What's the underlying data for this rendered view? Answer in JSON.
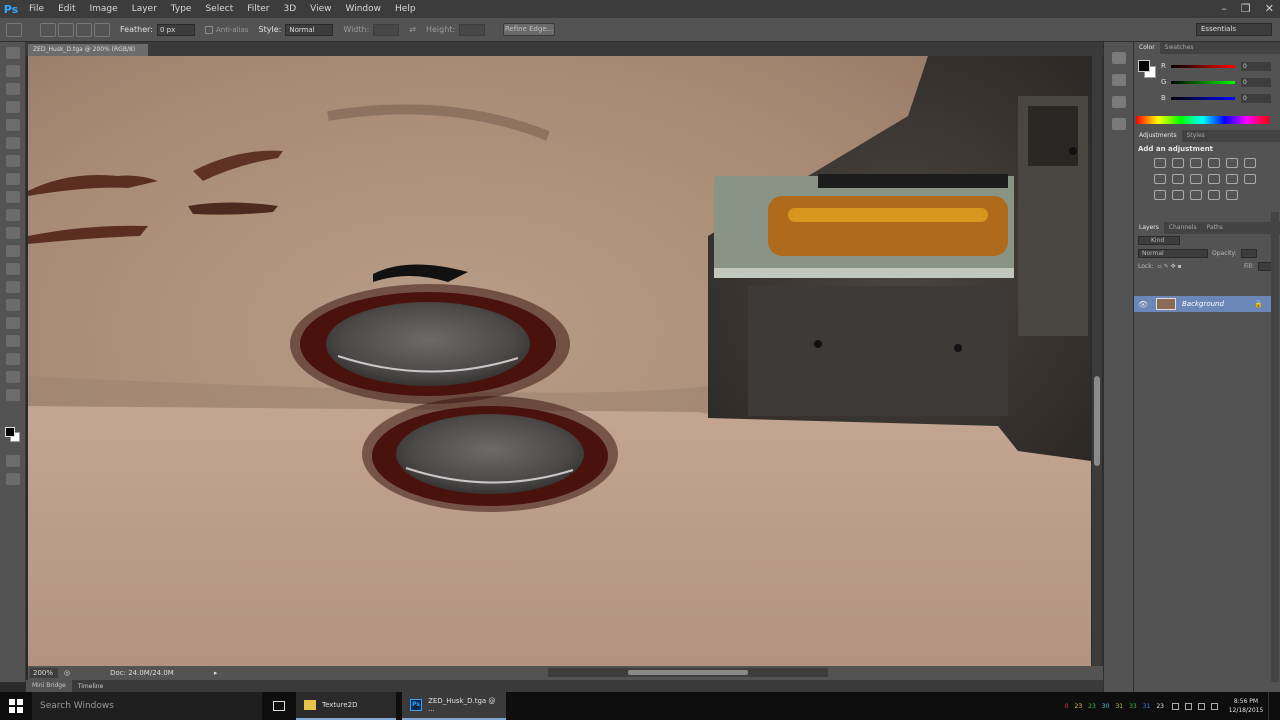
{
  "app": {
    "logo": "Ps"
  },
  "menu": [
    "File",
    "Edit",
    "Image",
    "Layer",
    "Type",
    "Select",
    "Filter",
    "3D",
    "View",
    "Window",
    "Help"
  ],
  "window_controls": [
    "–",
    "❐",
    "✕"
  ],
  "options": {
    "feather_label": "Feather:",
    "feather_value": "0 px",
    "antialias_label": "Anti-alias",
    "style_label": "Style:",
    "style_value": "Normal",
    "width_label": "Width:",
    "height_label": "Height:",
    "refine_label": "Refine Edge...",
    "workspace": "Essentials"
  },
  "document": {
    "tab_title": "ZED_Husk_D.tga @ 200% (RGB/8)",
    "zoom": "200%",
    "doc_info": "Doc: 24.0M/24.0M"
  },
  "bridge_tabs": [
    "Mini Bridge",
    "Timeline"
  ],
  "color_panel": {
    "tabs": [
      "Color",
      "Swatches"
    ],
    "channels": [
      {
        "label": "R",
        "value": "0",
        "color": "#d02020"
      },
      {
        "label": "G",
        "value": "0",
        "color": "#20b020"
      },
      {
        "label": "B",
        "value": "0",
        "color": "#2050d0"
      }
    ]
  },
  "adjustments_panel": {
    "tabs": [
      "Adjustments",
      "Styles"
    ],
    "title": "Add an adjustment"
  },
  "layers_panel": {
    "tabs": [
      "Layers",
      "Channels",
      "Paths"
    ],
    "kind": "Kind",
    "blend": "Normal",
    "opacity_label": "Opacity:",
    "lock_label": "Lock:",
    "fill_label": "Fill:",
    "layer_name": "Background"
  },
  "taskbar": {
    "search_placeholder": "Search Windows",
    "folder_task": "Texture2D",
    "ps_task": "ZED_Husk_D.tga @ ...",
    "tray_numbers": [
      "0",
      "23",
      "23",
      "30",
      "31",
      "33",
      "31",
      "23"
    ],
    "time": "8:56 PM",
    "date": "12/18/2015"
  },
  "colors": {
    "accent": "#31a8ff",
    "panel": "#535353",
    "selected_layer": "#6a87b8"
  }
}
